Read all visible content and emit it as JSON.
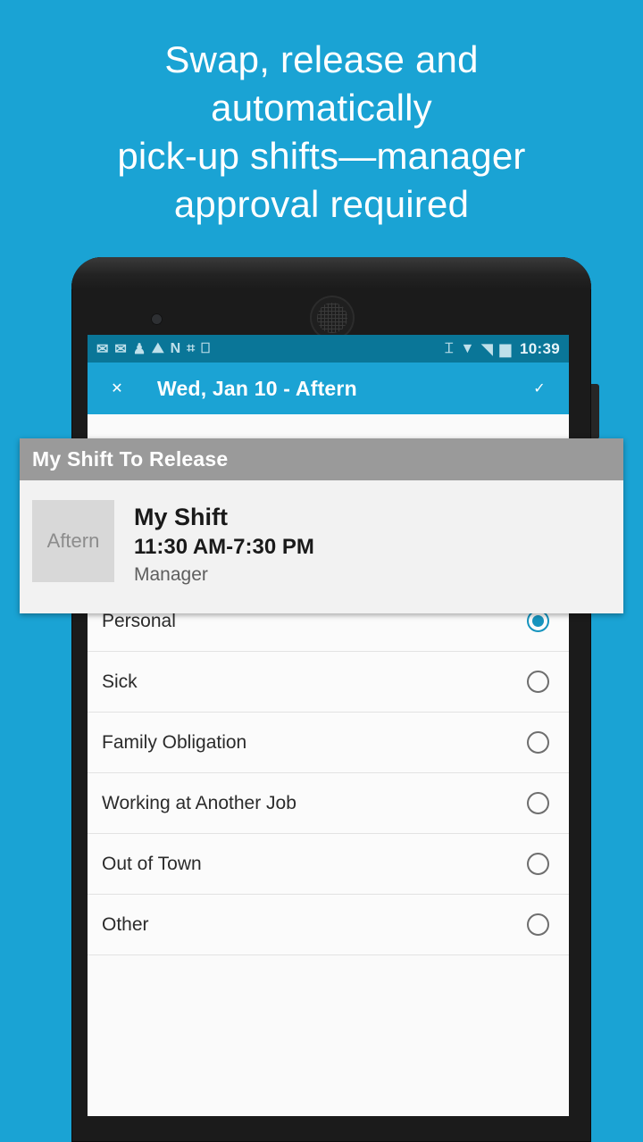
{
  "promo": {
    "lines": [
      "Swap, release and",
      "automatically",
      "pick-up shifts—manager",
      "approval required"
    ]
  },
  "colors": {
    "background_blue": "#1aa3d4",
    "appbar_blue": "#1ba3d4",
    "statusbar_blue": "#0a7698",
    "card_header_gray": "#9a9a9a",
    "accent_radio_blue": "#1694be",
    "phone_body": "#1b1b1b"
  },
  "status_bar": {
    "left_icons": [
      {
        "name": "gmail-icon",
        "glyph": "✉"
      },
      {
        "name": "gmail-icon",
        "glyph": "✉"
      },
      {
        "name": "person-icon",
        "glyph": "♟"
      },
      {
        "name": "photo-icon",
        "glyph": "⛰"
      },
      {
        "name": "n-app-icon",
        "glyph": "N"
      },
      {
        "name": "qr-scan-icon",
        "glyph": "⌗"
      },
      {
        "name": "device-icon",
        "glyph": "⎕"
      }
    ],
    "right_icons": [
      {
        "name": "vibrate-icon",
        "glyph": "⌶"
      },
      {
        "name": "wifi-icon",
        "glyph": "▼"
      },
      {
        "name": "signal-icon",
        "glyph": "◥"
      },
      {
        "name": "battery-icon",
        "glyph": "▆"
      }
    ],
    "time": "10:39"
  },
  "app_bar": {
    "close_icon": "✕",
    "title": "Wed, Jan 10 - Aftern",
    "confirm_icon": "✓"
  },
  "shift_card": {
    "header": "My Shift To Release",
    "badge": "Aftern",
    "title": "My Shift",
    "time_range": "11:30 AM-7:30 PM",
    "role": "Manager"
  },
  "reason_list": {
    "selected": "Personal",
    "items": [
      {
        "label": "Personal",
        "selected": true
      },
      {
        "label": "Sick",
        "selected": false
      },
      {
        "label": "Family Obligation",
        "selected": false
      },
      {
        "label": "Working at Another Job",
        "selected": false
      },
      {
        "label": "Out of Town",
        "selected": false
      },
      {
        "label": "Other",
        "selected": false
      }
    ]
  }
}
